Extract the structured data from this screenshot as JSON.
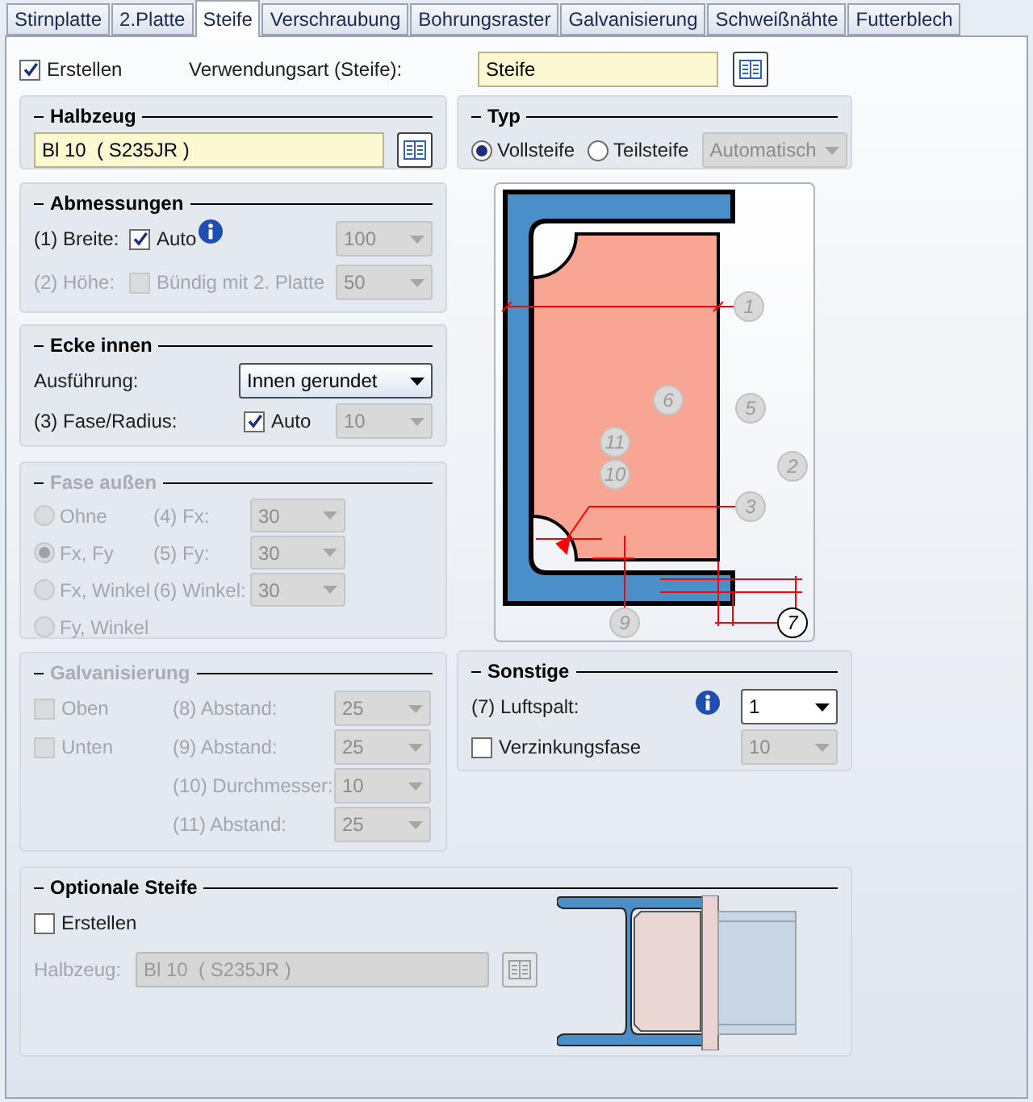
{
  "tabs": [
    {
      "label": "Stirnplatte",
      "selected": false
    },
    {
      "label": "2.Platte",
      "selected": false
    },
    {
      "label": "Steife",
      "selected": true
    },
    {
      "label": "Verschraubung",
      "selected": false
    },
    {
      "label": "Bohrungsraster",
      "selected": false
    },
    {
      "label": "Galvanisierung",
      "selected": false
    },
    {
      "label": "Schweißnähte",
      "selected": false
    },
    {
      "label": "Futterblech",
      "selected": false
    }
  ],
  "create": {
    "label": "Erstellen",
    "checked": true
  },
  "usage": {
    "label": "Verwendungsart (Steife):",
    "value": "Steife"
  },
  "halbzeug": {
    "title": "Halbzeug",
    "value": "Bl 10  ( S235JR )"
  },
  "typ": {
    "title": "Typ",
    "options": [
      {
        "label": "Vollsteife",
        "selected": true
      },
      {
        "label": "Teilsteife",
        "selected": false
      }
    ],
    "select": {
      "value": "Automatisch",
      "disabled": true
    }
  },
  "abmessungen": {
    "title": "Abmessungen",
    "rows": [
      {
        "label": "(1) Breite:",
        "disabled": false,
        "check": {
          "label": "Auto",
          "checked": true
        },
        "info": true,
        "select": {
          "value": "100",
          "disabled": true
        }
      },
      {
        "label": "(2) Höhe:",
        "disabled": true,
        "check": {
          "label": "Bündig mit 2. Platte",
          "checked": false
        },
        "info": false,
        "select": {
          "value": "50",
          "disabled": true
        }
      }
    ]
  },
  "ecke_innen": {
    "title": "Ecke innen",
    "execution": {
      "label": "Ausführung:",
      "value": "Innen gerundet"
    },
    "radius": {
      "label": "(3) Fase/Radius:",
      "check": {
        "label": "Auto",
        "checked": true
      },
      "select": {
        "value": "10",
        "disabled": true
      }
    }
  },
  "fase_aussen": {
    "title": "Fase außen",
    "disabled": true,
    "options": [
      {
        "label": "Ohne",
        "selected": false
      },
      {
        "label": "Fx, Fy",
        "selected": true
      },
      {
        "label": "Fx, Winkel",
        "selected": false
      },
      {
        "label": "Fy, Winkel",
        "selected": false
      }
    ],
    "fields": [
      {
        "label": "(4) Fx:",
        "value": "30"
      },
      {
        "label": "(5) Fy:",
        "value": "30"
      },
      {
        "label": "(6) Winkel:",
        "value": "30"
      }
    ]
  },
  "galvanisierung": {
    "title": "Galvanisierung",
    "disabled": true,
    "checks": [
      {
        "label": "Oben",
        "checked": false
      },
      {
        "label": "Unten",
        "checked": false
      }
    ],
    "fields": [
      {
        "label": "(8) Abstand:",
        "value": "25"
      },
      {
        "label": "(9) Abstand:",
        "value": "25"
      },
      {
        "label": "(10) Durchmesser:",
        "value": "10"
      },
      {
        "label": "(11) Abstand:",
        "value": "25"
      }
    ]
  },
  "diagram": {
    "markers": [
      {
        "label": "1",
        "highlighted": false
      },
      {
        "label": "6",
        "highlighted": false
      },
      {
        "label": "5",
        "highlighted": false
      },
      {
        "label": "2",
        "highlighted": false
      },
      {
        "label": "11",
        "highlighted": false
      },
      {
        "label": "10",
        "highlighted": false
      },
      {
        "label": "3",
        "highlighted": false
      },
      {
        "label": "9",
        "highlighted": false
      },
      {
        "label": "7",
        "highlighted": true
      }
    ]
  },
  "sonstige": {
    "title": "Sonstige",
    "gap": {
      "label": "(7) Luftspalt:",
      "info": true,
      "value": "1"
    },
    "zinc": {
      "label": "Verzinkungsfase",
      "checked": false,
      "select": {
        "value": "10",
        "disabled": true
      }
    }
  },
  "optional": {
    "title": "Optionale Steife",
    "create": {
      "label": "Erstellen",
      "checked": false
    },
    "halbzeug": {
      "label": "Halbzeug:",
      "value": "Bl 10  ( S235JR )",
      "disabled": true
    }
  }
}
